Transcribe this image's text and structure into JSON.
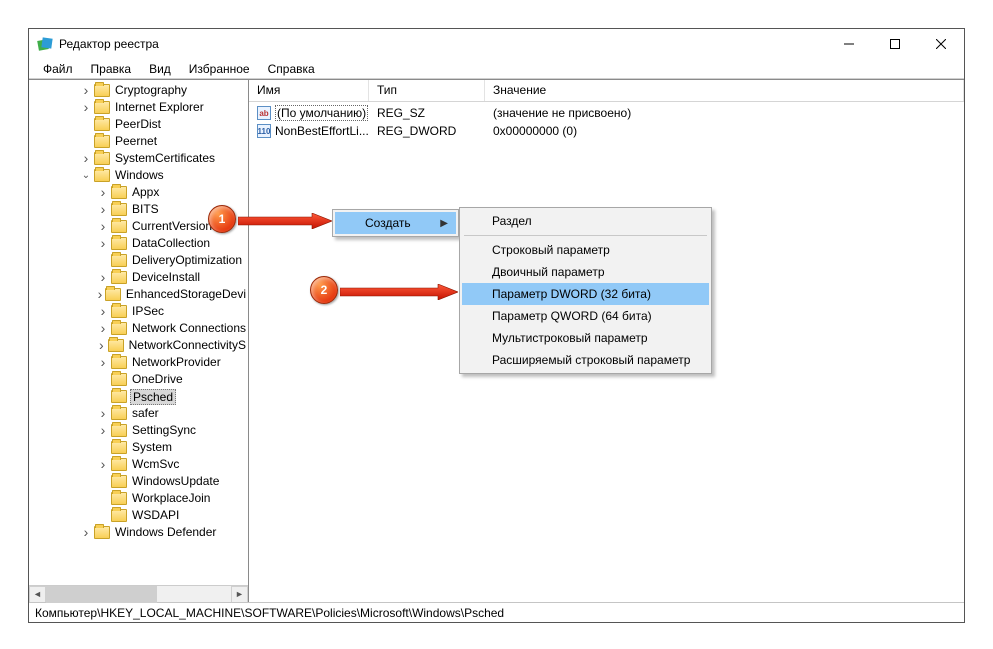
{
  "window": {
    "title": "Редактор реестра"
  },
  "menu": {
    "file": "Файл",
    "edit": "Правка",
    "view": "Вид",
    "favorites": "Избранное",
    "help": "Справка"
  },
  "tree": [
    {
      "indent": 3,
      "toggle": ">",
      "label": "Cryptography"
    },
    {
      "indent": 3,
      "toggle": ">",
      "label": "Internet Explorer"
    },
    {
      "indent": 3,
      "toggle": "",
      "label": "PeerDist"
    },
    {
      "indent": 3,
      "toggle": "",
      "label": "Peernet"
    },
    {
      "indent": 3,
      "toggle": ">",
      "label": "SystemCertificates"
    },
    {
      "indent": 3,
      "toggle": "v",
      "label": "Windows"
    },
    {
      "indent": 4,
      "toggle": ">",
      "label": "Appx"
    },
    {
      "indent": 4,
      "toggle": ">",
      "label": "BITS"
    },
    {
      "indent": 4,
      "toggle": ">",
      "label": "CurrentVersion"
    },
    {
      "indent": 4,
      "toggle": ">",
      "label": "DataCollection"
    },
    {
      "indent": 4,
      "toggle": "",
      "label": "DeliveryOptimization"
    },
    {
      "indent": 4,
      "toggle": ">",
      "label": "DeviceInstall"
    },
    {
      "indent": 4,
      "toggle": ">",
      "label": "EnhancedStorageDevi"
    },
    {
      "indent": 4,
      "toggle": ">",
      "label": "IPSec"
    },
    {
      "indent": 4,
      "toggle": ">",
      "label": "Network Connections"
    },
    {
      "indent": 4,
      "toggle": ">",
      "label": "NetworkConnectivityS"
    },
    {
      "indent": 4,
      "toggle": ">",
      "label": "NetworkProvider"
    },
    {
      "indent": 4,
      "toggle": "",
      "label": "OneDrive"
    },
    {
      "indent": 4,
      "toggle": "",
      "label": "Psched",
      "selected": true
    },
    {
      "indent": 4,
      "toggle": ">",
      "label": "safer"
    },
    {
      "indent": 4,
      "toggle": ">",
      "label": "SettingSync"
    },
    {
      "indent": 4,
      "toggle": "",
      "label": "System"
    },
    {
      "indent": 4,
      "toggle": ">",
      "label": "WcmSvc"
    },
    {
      "indent": 4,
      "toggle": "",
      "label": "WindowsUpdate"
    },
    {
      "indent": 4,
      "toggle": "",
      "label": "WorkplaceJoin"
    },
    {
      "indent": 4,
      "toggle": "",
      "label": "WSDAPI"
    },
    {
      "indent": 3,
      "toggle": ">",
      "label": "Windows Defender"
    }
  ],
  "columns": {
    "name": "Имя",
    "type": "Тип",
    "value": "Значение"
  },
  "rows": [
    {
      "icon": "str",
      "name": "(По умолчанию)",
      "type": "REG_SZ",
      "value": "(значение не присвоено)",
      "focused": true
    },
    {
      "icon": "bin",
      "name": "NonBestEffortLi...",
      "type": "REG_DWORD",
      "value": "0x00000000 (0)"
    }
  ],
  "status": "Компьютер\\HKEY_LOCAL_MACHINE\\SOFTWARE\\Policies\\Microsoft\\Windows\\Psched",
  "ctx1": {
    "create": "Создать"
  },
  "ctx2": {
    "key": "Раздел",
    "string": "Строковый параметр",
    "binary": "Двоичный параметр",
    "dword": "Параметр DWORD (32 бита)",
    "qword": "Параметр QWORD (64 бита)",
    "multi": "Мультистроковый параметр",
    "expand": "Расширяемый строковый параметр"
  },
  "markers": {
    "one": "1",
    "two": "2"
  }
}
